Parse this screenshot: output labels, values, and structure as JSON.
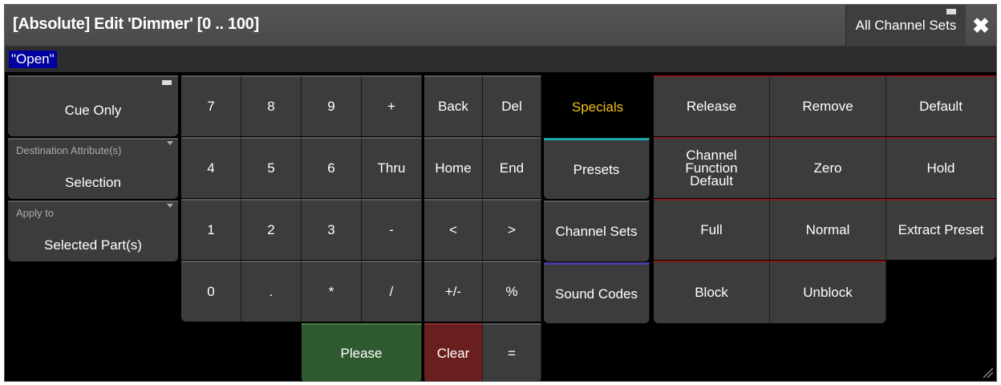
{
  "title": "[Absolute] Edit 'Dimmer' [0 .. 100]",
  "channel_sets_label": "All Channel Sets",
  "close_glyph": "✖",
  "input_value": "\"Open\"",
  "options": {
    "cue_only": "Cue Only",
    "destination_caption": "Destination Attribute(s)",
    "destination_value": "Selection",
    "apply_caption": "Apply to",
    "apply_value": "Selected Part(s)"
  },
  "keypad": {
    "row1": [
      "7",
      "8",
      "9",
      "+"
    ],
    "row2": [
      "4",
      "5",
      "6",
      "Thru"
    ],
    "row3": [
      "1",
      "2",
      "3",
      "-"
    ],
    "row4": [
      "0",
      ".",
      "*",
      "/"
    ],
    "please": "Please"
  },
  "edit": {
    "back": "Back",
    "del": "Del",
    "home": "Home",
    "end": "End",
    "lt": "<",
    "gt": ">",
    "plusminus": "+/-",
    "percent": "%",
    "clear": "Clear",
    "equals": "="
  },
  "tabs": {
    "specials": "Specials",
    "presets": "Presets",
    "channel_sets": "Channel Sets",
    "sound_codes": "Sound Codes"
  },
  "specials": {
    "release": "Release",
    "remove": "Remove",
    "default": "Default",
    "channel_function_default": "Channel Function Default",
    "zero": "Zero",
    "hold": "Hold",
    "full": "Full",
    "normal": "Normal",
    "extract_preset": "Extract Preset",
    "block": "Block",
    "unblock": "Unblock"
  },
  "colors": {
    "accent_yellow": "#f2c01d",
    "please_green": "#2f5a2f",
    "clear_red": "#6a1f1f",
    "selection_blue": "#0000a0"
  }
}
